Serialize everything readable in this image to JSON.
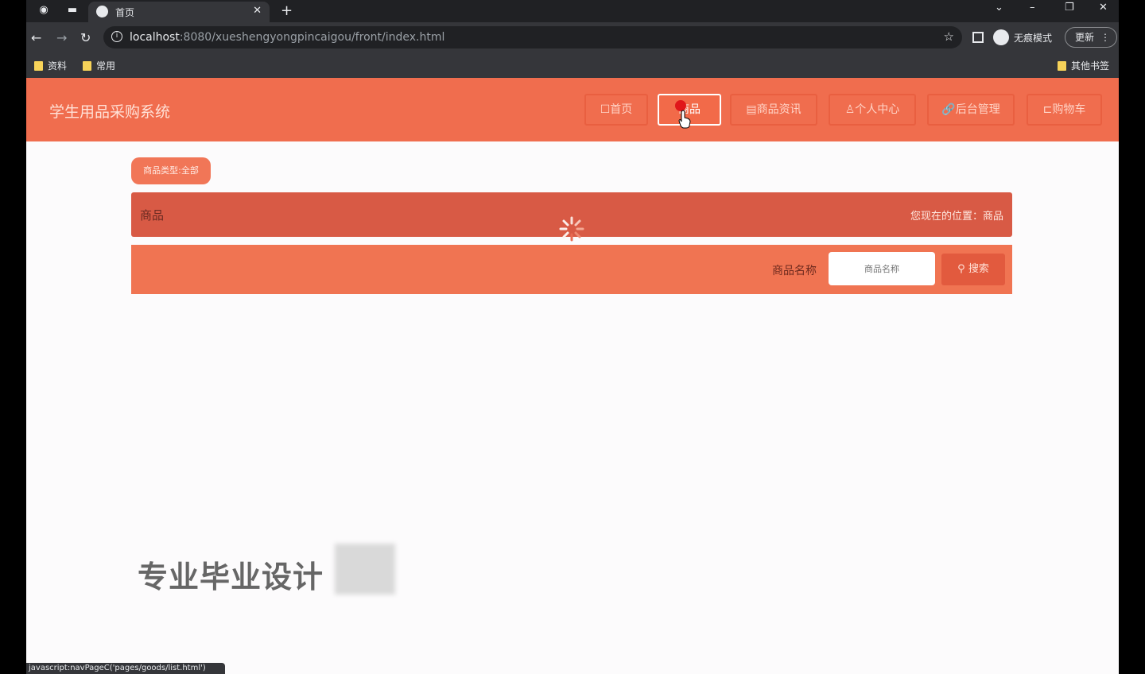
{
  "browser": {
    "tab_title": "首页",
    "tab_close": "✕",
    "new_tab": "+",
    "url_host": "localhost",
    "url_path": ":8080/xueshengyongpincaigou/front/index.html",
    "incognito_label": "无痕模式",
    "update_label": "更新",
    "bookmarks": [
      "资料",
      "常用"
    ],
    "other_bookmarks": "其他书签",
    "status_url": "javascript:navPageC('pages/goods/list.html')"
  },
  "header": {
    "brand": "学生用品采购系统",
    "nav": [
      "首页",
      "商品",
      "商品资讯",
      "个人中心",
      "后台管理",
      "购物车"
    ]
  },
  "main": {
    "filter_pill": "商品类型:全部",
    "section_title": "商品",
    "location": "您现在的位置：商品",
    "search_label": "商品名称",
    "search_placeholder": "商品名称",
    "search_button": "搜索"
  },
  "overlay": {
    "watermark": "专业毕业设计"
  },
  "colors": {
    "header": "#f06d4e",
    "crumb_bar": "#d85a45",
    "search_bar": "#f07452"
  }
}
